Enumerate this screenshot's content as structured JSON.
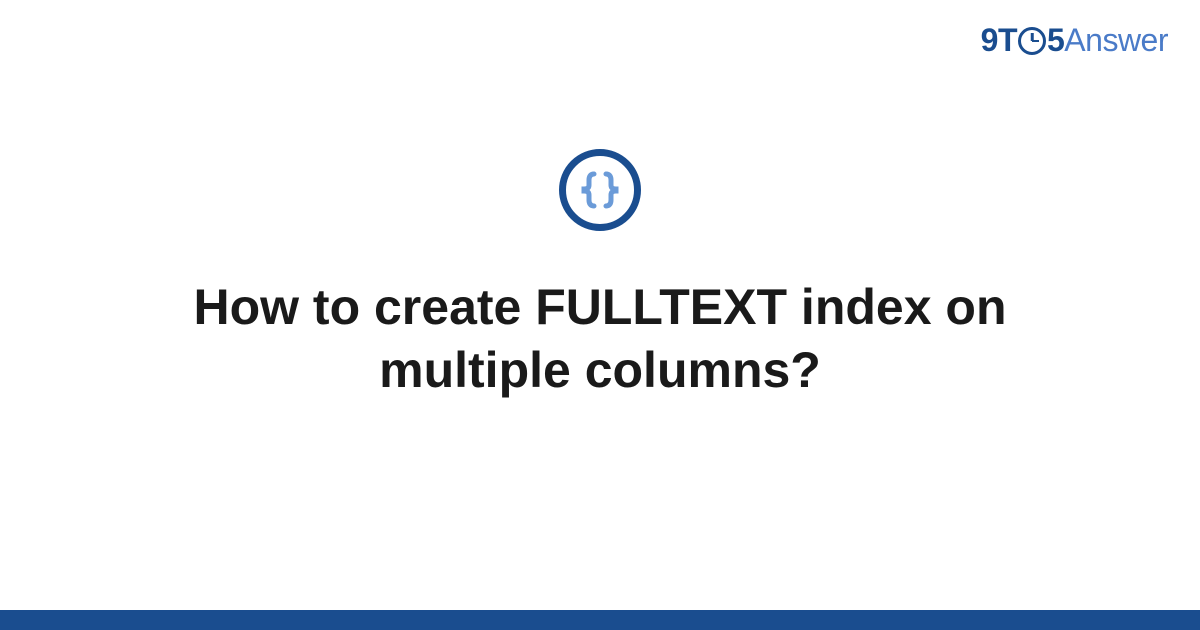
{
  "brand": {
    "part1": "9T",
    "part2": "5",
    "part3": "Answer"
  },
  "badge": {
    "icon_name": "braces-icon"
  },
  "title": "How to create FULLTEXT index on multiple columns?",
  "colors": {
    "primary": "#1a4d8f",
    "accent": "#4a7bc8",
    "brace": "#6b9bd8"
  }
}
